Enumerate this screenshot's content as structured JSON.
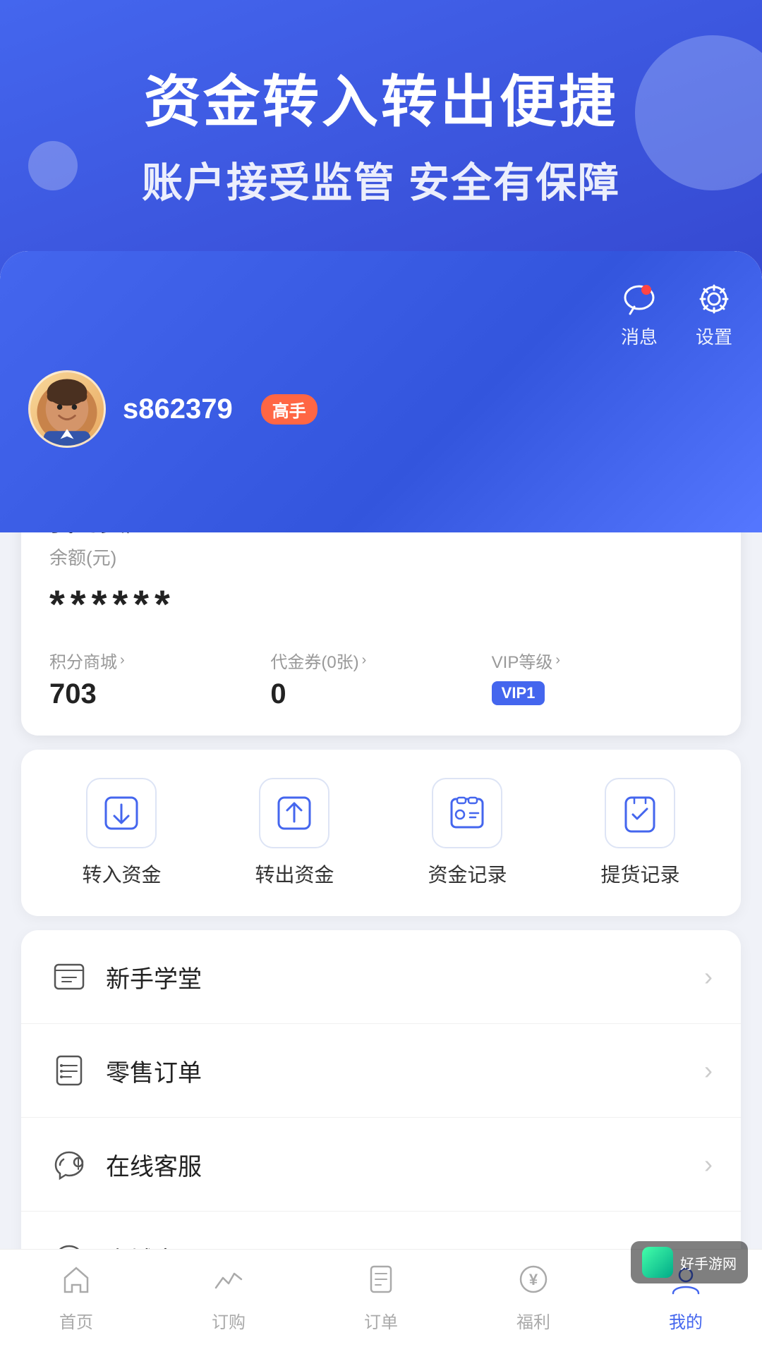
{
  "header": {
    "title1": "资金转入转出便捷",
    "title2": "账户接受监管 安全有保障"
  },
  "profile": {
    "message_label": "消息",
    "settings_label": "设置",
    "username": "s862379",
    "badge": "高手"
  },
  "assets": {
    "title": "我的资产",
    "balance_label": "余额(元)",
    "balance_value": "******",
    "points_label": "积分商城",
    "points_value": "703",
    "voucher_label": "代金券(0张)",
    "voucher_value": "0",
    "vip_label": "VIP等级",
    "vip_badge": "VIP1"
  },
  "actions": [
    {
      "label": "转入资金",
      "icon": "⬇"
    },
    {
      "label": "转出资金",
      "icon": "⬆"
    },
    {
      "label": "资金记录",
      "icon": "💳"
    },
    {
      "label": "提货记录",
      "icon": "✅"
    }
  ],
  "menu": [
    {
      "label": "新手学堂",
      "icon": "📖"
    },
    {
      "label": "零售订单",
      "icon": "📋"
    },
    {
      "label": "在线客服",
      "icon": "🎧"
    },
    {
      "label": "商城客服",
      "icon": "🎧"
    }
  ],
  "bottom_nav": [
    {
      "label": "首页",
      "icon": "🏠",
      "active": false
    },
    {
      "label": "订购",
      "icon": "📈",
      "active": false
    },
    {
      "label": "订单",
      "icon": "📋",
      "active": false
    },
    {
      "label": "福利",
      "icon": "¥",
      "active": false
    },
    {
      "label": "我的",
      "icon": "👤",
      "active": true
    }
  ],
  "watermark": {
    "text": "好手游网"
  }
}
